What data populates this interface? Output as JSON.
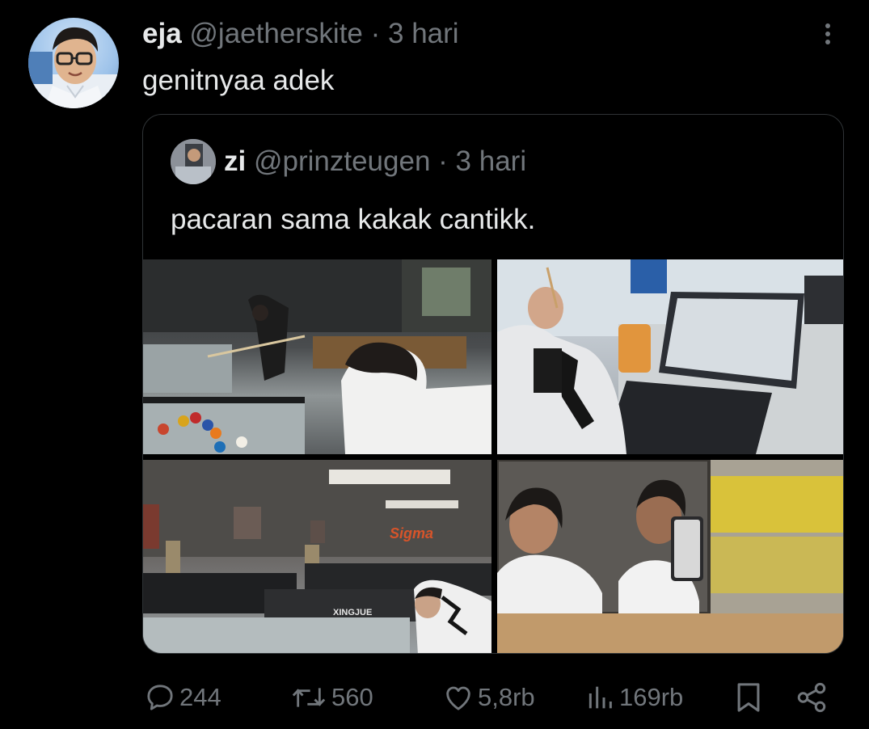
{
  "tweet": {
    "display_name": "eja",
    "handle": "@jaetherskite",
    "separator": "·",
    "time": "3 hari",
    "text": "genitnyaa adek"
  },
  "quoted": {
    "display_name": "zi",
    "handle": "@prinzteugen",
    "separator": "·",
    "time": "3 hari",
    "text": "pacaran sama kakak cantikk.",
    "photos": [
      {
        "name": "billiard-hall-photo"
      },
      {
        "name": "laptop-cafe-photo"
      },
      {
        "name": "billiard-room-photo"
      },
      {
        "name": "mirror-selfie-photo"
      }
    ],
    "photo_text": {
      "sign": "Sigma",
      "table_brand": "XINGJUE"
    }
  },
  "actions": {
    "replies": "244",
    "reposts": "560",
    "likes": "5,8rb",
    "views": "169rb"
  },
  "icons": [
    "more-icon",
    "reply-icon",
    "repost-icon",
    "like-icon",
    "views-icon",
    "bookmark-icon",
    "share-icon"
  ],
  "colors": {
    "background": "#000000",
    "text": "#e7e9ea",
    "muted": "#71767b",
    "border": "#2f3336"
  }
}
